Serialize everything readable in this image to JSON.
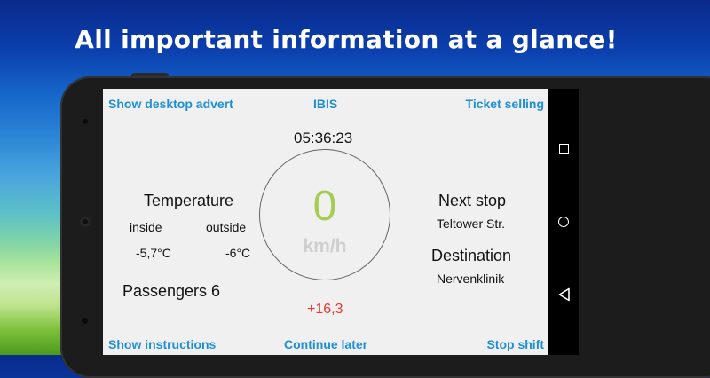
{
  "headline": "All important information at a glance!",
  "app": {
    "top_left_link": "Show desktop advert",
    "title": "IBIS",
    "top_right_link": "Ticket selling",
    "clock": "05:36:23",
    "temperature": {
      "label": "Temperature",
      "inside_label": "inside",
      "outside_label": "outside",
      "inside_value": "-5,7°C",
      "outside_value": "-6°C"
    },
    "passengers": "Passengers 6",
    "speed": {
      "value": "0",
      "unit": "km/h",
      "deviation": "+16,3",
      "deviation_color": "#e53935",
      "speed_color": "#a6cc53"
    },
    "next_stop": {
      "label": "Next stop",
      "value": "Teltower Str."
    },
    "destination": {
      "label": "Destination",
      "value": "Nervenklinik"
    },
    "bottom_left_link": "Show instructions",
    "bottom_center_link": "Continue later",
    "bottom_right_link": "Stop shift",
    "accent_color": "#1e8fd6"
  },
  "system_nav": {
    "recents_icon": "square-icon",
    "home_icon": "circle-icon",
    "back_icon": "triangle-back-icon"
  }
}
